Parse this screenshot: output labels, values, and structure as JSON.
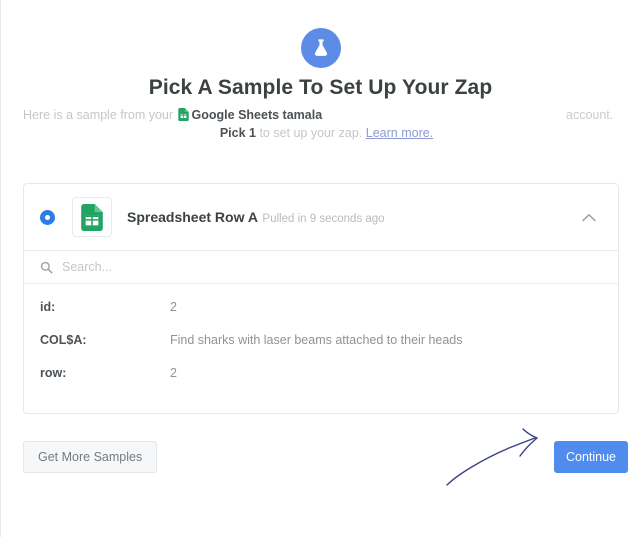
{
  "header": {
    "hero_icon": "flask-icon",
    "title": "Pick A Sample To Set Up Your Zap",
    "subtitle_lead": "Here is a sample from your",
    "account_icon": "google-sheets-icon",
    "account_name": "Google Sheets tamala",
    "subtitle_tail": "account.",
    "pick_strong": "Pick 1",
    "pick_rest": "to set up your zap.",
    "learn_more": "Learn more."
  },
  "sample_card": {
    "radio_selected": true,
    "app_icon": "google-sheets-icon",
    "title": "Spreadsheet Row A",
    "pulled_label": "Pulled in 9 seconds ago",
    "collapse_icon": "chevron-up-icon",
    "search": {
      "icon": "search-icon",
      "placeholder": "Search...",
      "value": ""
    },
    "fields": [
      {
        "key": "id:",
        "value": "2"
      },
      {
        "key": "COL$A:",
        "value": "Find sharks with laser beams attached to their heads"
      },
      {
        "key": "row:",
        "value": "2"
      }
    ]
  },
  "footer": {
    "get_more_samples": "Get More Samples",
    "continue": "Continue"
  },
  "annotation": {
    "type": "hand-drawn-arrow",
    "color": "#3b3f8c",
    "points_to": "continue-button"
  },
  "colors": {
    "accent_blue": "#4f8ced",
    "hero_blue": "#5c8ce6",
    "radio_blue": "#2e7ce4",
    "sheets_green": "#22a463",
    "text_dark": "#3c4142",
    "text_muted": "#b9bfc4",
    "border": "#e6e9ec",
    "secondary_btn_bg": "#f6f7f8",
    "annotation_navy": "#3b3f8c"
  }
}
